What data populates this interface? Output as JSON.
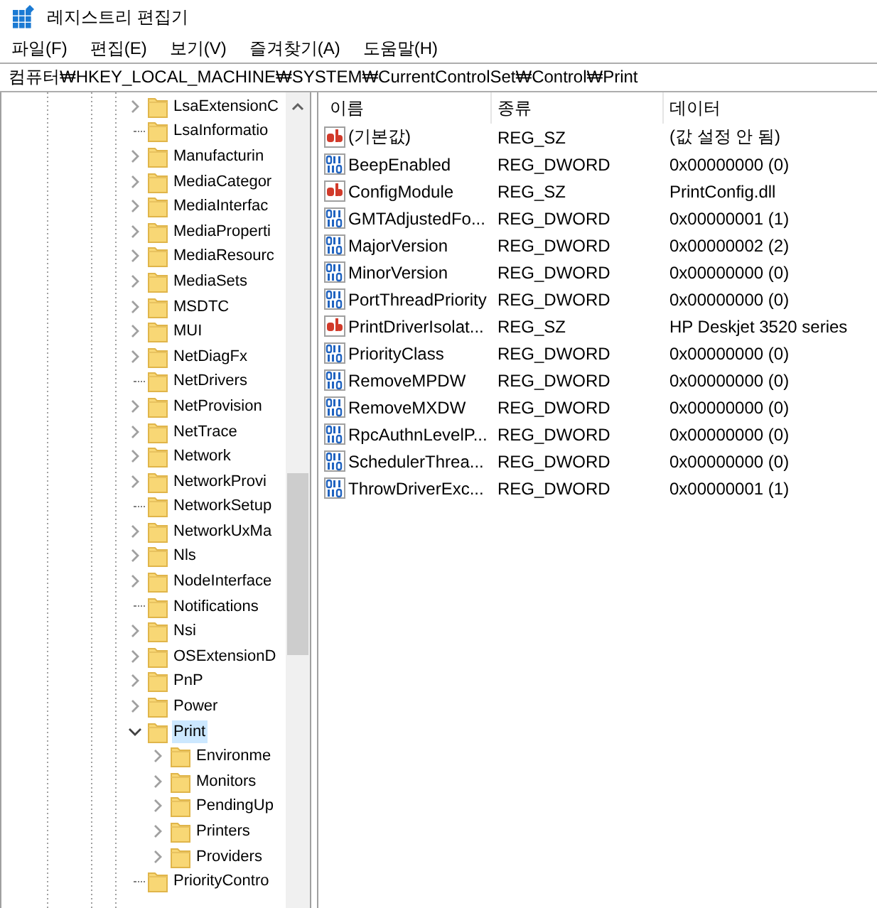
{
  "window": {
    "title": "레지스트리 편집기"
  },
  "menu": [
    "파일(F)",
    "편집(E)",
    "보기(V)",
    "즐겨찾기(A)",
    "도움말(H)"
  ],
  "address": "컴퓨터₩HKEY_LOCAL_MACHINE₩SYSTEM₩CurrentControlSet₩Control₩Print",
  "tree": [
    {
      "label": "LsaExtensionC",
      "expandable": true,
      "expanded": false,
      "selected": false
    },
    {
      "label": "LsaInformatio",
      "expandable": false,
      "selected": false
    },
    {
      "label": "Manufacturin",
      "expandable": true,
      "expanded": false,
      "selected": false
    },
    {
      "label": "MediaCategor",
      "expandable": true,
      "expanded": false,
      "selected": false
    },
    {
      "label": "MediaInterfac",
      "expandable": true,
      "expanded": false,
      "selected": false
    },
    {
      "label": "MediaProperti",
      "expandable": true,
      "expanded": false,
      "selected": false
    },
    {
      "label": "MediaResourc",
      "expandable": true,
      "expanded": false,
      "selected": false
    },
    {
      "label": "MediaSets",
      "expandable": true,
      "expanded": false,
      "selected": false
    },
    {
      "label": "MSDTC",
      "expandable": true,
      "expanded": false,
      "selected": false
    },
    {
      "label": "MUI",
      "expandable": true,
      "expanded": false,
      "selected": false
    },
    {
      "label": "NetDiagFx",
      "expandable": true,
      "expanded": false,
      "selected": false
    },
    {
      "label": "NetDrivers",
      "expandable": false,
      "selected": false
    },
    {
      "label": "NetProvision",
      "expandable": true,
      "expanded": false,
      "selected": false
    },
    {
      "label": "NetTrace",
      "expandable": true,
      "expanded": false,
      "selected": false
    },
    {
      "label": "Network",
      "expandable": true,
      "expanded": false,
      "selected": false
    },
    {
      "label": "NetworkProvi",
      "expandable": true,
      "expanded": false,
      "selected": false
    },
    {
      "label": "NetworkSetup",
      "expandable": false,
      "selected": false
    },
    {
      "label": "NetworkUxMa",
      "expandable": true,
      "expanded": false,
      "selected": false
    },
    {
      "label": "Nls",
      "expandable": true,
      "expanded": false,
      "selected": false
    },
    {
      "label": "NodeInterface",
      "expandable": true,
      "expanded": false,
      "selected": false
    },
    {
      "label": "Notifications",
      "expandable": false,
      "selected": false
    },
    {
      "label": "Nsi",
      "expandable": true,
      "expanded": false,
      "selected": false
    },
    {
      "label": "OSExtensionD",
      "expandable": true,
      "expanded": false,
      "selected": false
    },
    {
      "label": "PnP",
      "expandable": true,
      "expanded": false,
      "selected": false
    },
    {
      "label": "Power",
      "expandable": true,
      "expanded": false,
      "selected": false
    },
    {
      "label": "Print",
      "expandable": true,
      "expanded": true,
      "selected": true,
      "children": [
        {
          "label": "Environme",
          "expandable": true,
          "expanded": false,
          "selected": false
        },
        {
          "label": "Monitors",
          "expandable": true,
          "expanded": false,
          "selected": false
        },
        {
          "label": "PendingUp",
          "expandable": true,
          "expanded": false,
          "selected": false
        },
        {
          "label": "Printers",
          "expandable": true,
          "expanded": false,
          "selected": false
        },
        {
          "label": "Providers",
          "expandable": true,
          "expanded": false,
          "selected": false
        }
      ]
    },
    {
      "label": "PriorityContro",
      "expandable": false,
      "selected": false
    }
  ],
  "list": {
    "columns": [
      "이름",
      "종류",
      "데이터"
    ],
    "rows": [
      {
        "kind": "string",
        "name": "(기본값)",
        "type": "REG_SZ",
        "data": "(값 설정 안 됨)"
      },
      {
        "kind": "dword",
        "name": "BeepEnabled",
        "type": "REG_DWORD",
        "data": "0x00000000 (0)"
      },
      {
        "kind": "string",
        "name": "ConfigModule",
        "type": "REG_SZ",
        "data": "PrintConfig.dll"
      },
      {
        "kind": "dword",
        "name": "GMTAdjustedFo...",
        "type": "REG_DWORD",
        "data": "0x00000001 (1)"
      },
      {
        "kind": "dword",
        "name": "MajorVersion",
        "type": "REG_DWORD",
        "data": "0x00000002 (2)"
      },
      {
        "kind": "dword",
        "name": "MinorVersion",
        "type": "REG_DWORD",
        "data": "0x00000000 (0)"
      },
      {
        "kind": "dword",
        "name": "PortThreadPriority",
        "type": "REG_DWORD",
        "data": "0x00000000 (0)"
      },
      {
        "kind": "string",
        "name": "PrintDriverIsolat...",
        "type": "REG_SZ",
        "data": "HP Deskjet 3520 series"
      },
      {
        "kind": "dword",
        "name": "PriorityClass",
        "type": "REG_DWORD",
        "data": "0x00000000 (0)"
      },
      {
        "kind": "dword",
        "name": "RemoveMPDW",
        "type": "REG_DWORD",
        "data": "0x00000000 (0)"
      },
      {
        "kind": "dword",
        "name": "RemoveMXDW",
        "type": "REG_DWORD",
        "data": "0x00000000 (0)"
      },
      {
        "kind": "dword",
        "name": "RpcAuthnLevelP...",
        "type": "REG_DWORD",
        "data": "0x00000000 (0)"
      },
      {
        "kind": "dword",
        "name": "SchedulerThrea...",
        "type": "REG_DWORD",
        "data": "0x00000000 (0)"
      },
      {
        "kind": "dword",
        "name": "ThrowDriverExc...",
        "type": "REG_DWORD",
        "data": "0x00000001 (1)"
      }
    ]
  }
}
